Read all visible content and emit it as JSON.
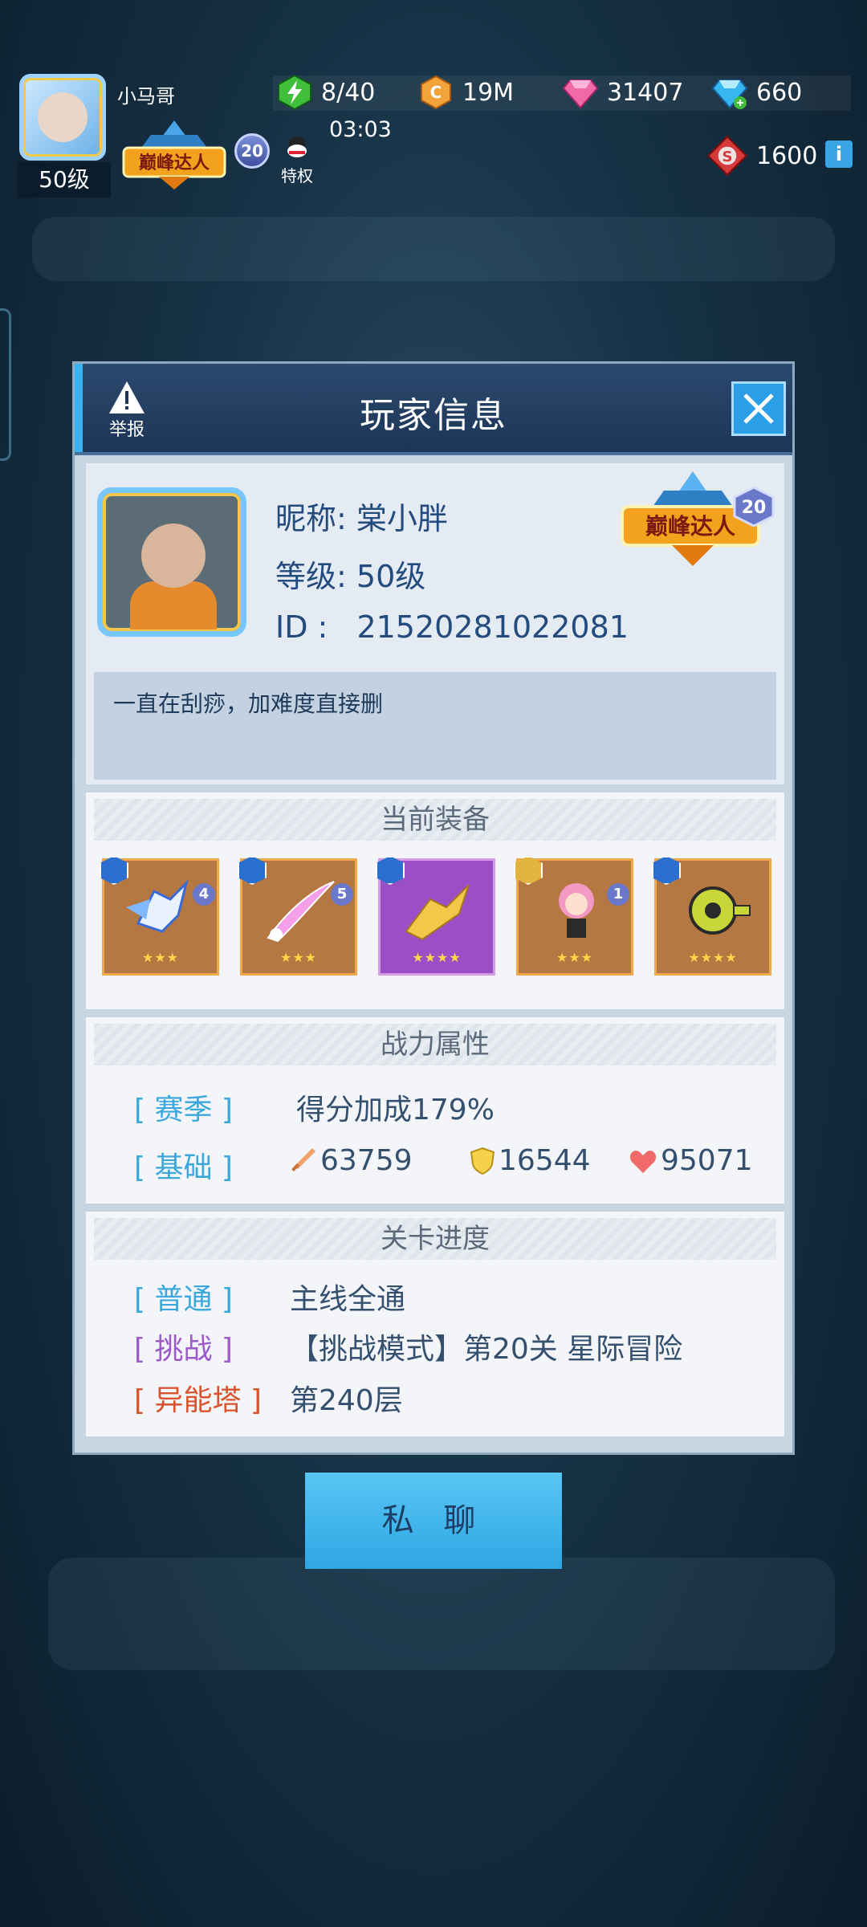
{
  "topbar": {
    "level": "50级",
    "player_name": "小马哥",
    "rank_title": "巅峰达人",
    "rank_star": "20",
    "privilege": "特权",
    "energy": "8/40",
    "energy_timer": "03:03",
    "gold": "19M",
    "pink_gem": "31407",
    "blue_gem": "660",
    "token": "1600",
    "info": "i"
  },
  "dialog": {
    "title": "玩家信息",
    "report": "举报",
    "profile": {
      "nickname_label": "昵称:",
      "nickname": "棠小胖",
      "level_label": "等级:",
      "level": "50级",
      "id_label": "ID  :",
      "id": "21520281022081",
      "rank_title": "巅峰达人",
      "rank_star": "20",
      "signature": "一直在刮痧，加难度直接删"
    },
    "equipment": {
      "title": "当前装备",
      "items": [
        {
          "stars": "★★★",
          "level": "4",
          "gem": "blue"
        },
        {
          "stars": "★★★",
          "level": "5",
          "gem": "blue"
        },
        {
          "stars": "★★★★",
          "level": "",
          "gem": "blue"
        },
        {
          "stars": "★★★",
          "level": "1",
          "gem": "gold"
        },
        {
          "stars": "★★★★",
          "level": "",
          "gem": "blue"
        }
      ]
    },
    "combat": {
      "title": "战力属性",
      "season_tag": "[ 赛季 ]",
      "season_value": "得分加成179%",
      "base_tag": "[ 基础 ]",
      "attack": "63759",
      "defense": "16544",
      "hp": "95071"
    },
    "progress": {
      "title": "关卡进度",
      "normal_tag": "[ 普通 ]",
      "normal_value": "主线全通",
      "challenge_tag": "[ 挑战 ]",
      "challenge_value": "【挑战模式】第20关 星际冒险",
      "tower_tag": "[ 异能塔 ]",
      "tower_value": "第240层"
    }
  },
  "chat_button": "私 聊",
  "colors": {
    "accent_blue": "#2fa6e4",
    "tag_blue": "#3aa7dd",
    "tag_purple": "#9b59c9",
    "tag_red": "#d9532c"
  },
  "icons": [
    "energy-icon",
    "gold-coin-icon",
    "pink-gem-icon",
    "blue-gem-icon",
    "token-icon",
    "info-icon",
    "warning-icon",
    "close-icon",
    "sword-icon",
    "shield-icon",
    "heart-icon"
  ]
}
